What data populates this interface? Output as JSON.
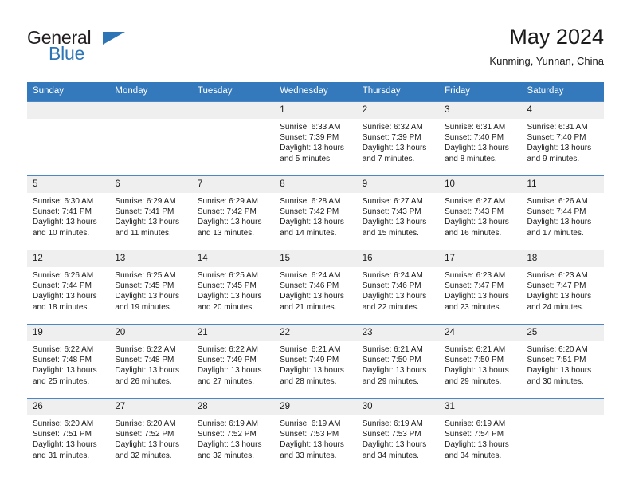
{
  "brand": {
    "name_primary": "General",
    "name_secondary": "Blue",
    "accent_color": "#2e75b6"
  },
  "header": {
    "title": "May 2024",
    "subtitle": "Kunming, Yunnan, China"
  },
  "theme": {
    "header_row_bg": "#3479bc",
    "daynum_bg": "#efefef",
    "row_separator": "#4a87c4"
  },
  "weekdays": [
    "Sunday",
    "Monday",
    "Tuesday",
    "Wednesday",
    "Thursday",
    "Friday",
    "Saturday"
  ],
  "labels": {
    "sunrise_prefix": "Sunrise:",
    "sunset_prefix": "Sunset:",
    "daylight_prefix": "Daylight:"
  },
  "weeks": [
    [
      {
        "day": "",
        "empty": true,
        "sunrise": "",
        "sunset": "",
        "daylight_l1": "",
        "daylight_l2": ""
      },
      {
        "day": "",
        "empty": true,
        "sunrise": "",
        "sunset": "",
        "daylight_l1": "",
        "daylight_l2": ""
      },
      {
        "day": "",
        "empty": true,
        "sunrise": "",
        "sunset": "",
        "daylight_l1": "",
        "daylight_l2": ""
      },
      {
        "day": "1",
        "empty": false,
        "sunrise": "Sunrise: 6:33 AM",
        "sunset": "Sunset: 7:39 PM",
        "daylight_l1": "Daylight: 13 hours",
        "daylight_l2": "and 5 minutes."
      },
      {
        "day": "2",
        "empty": false,
        "sunrise": "Sunrise: 6:32 AM",
        "sunset": "Sunset: 7:39 PM",
        "daylight_l1": "Daylight: 13 hours",
        "daylight_l2": "and 7 minutes."
      },
      {
        "day": "3",
        "empty": false,
        "sunrise": "Sunrise: 6:31 AM",
        "sunset": "Sunset: 7:40 PM",
        "daylight_l1": "Daylight: 13 hours",
        "daylight_l2": "and 8 minutes."
      },
      {
        "day": "4",
        "empty": false,
        "sunrise": "Sunrise: 6:31 AM",
        "sunset": "Sunset: 7:40 PM",
        "daylight_l1": "Daylight: 13 hours",
        "daylight_l2": "and 9 minutes."
      }
    ],
    [
      {
        "day": "5",
        "empty": false,
        "sunrise": "Sunrise: 6:30 AM",
        "sunset": "Sunset: 7:41 PM",
        "daylight_l1": "Daylight: 13 hours",
        "daylight_l2": "and 10 minutes."
      },
      {
        "day": "6",
        "empty": false,
        "sunrise": "Sunrise: 6:29 AM",
        "sunset": "Sunset: 7:41 PM",
        "daylight_l1": "Daylight: 13 hours",
        "daylight_l2": "and 11 minutes."
      },
      {
        "day": "7",
        "empty": false,
        "sunrise": "Sunrise: 6:29 AM",
        "sunset": "Sunset: 7:42 PM",
        "daylight_l1": "Daylight: 13 hours",
        "daylight_l2": "and 13 minutes."
      },
      {
        "day": "8",
        "empty": false,
        "sunrise": "Sunrise: 6:28 AM",
        "sunset": "Sunset: 7:42 PM",
        "daylight_l1": "Daylight: 13 hours",
        "daylight_l2": "and 14 minutes."
      },
      {
        "day": "9",
        "empty": false,
        "sunrise": "Sunrise: 6:27 AM",
        "sunset": "Sunset: 7:43 PM",
        "daylight_l1": "Daylight: 13 hours",
        "daylight_l2": "and 15 minutes."
      },
      {
        "day": "10",
        "empty": false,
        "sunrise": "Sunrise: 6:27 AM",
        "sunset": "Sunset: 7:43 PM",
        "daylight_l1": "Daylight: 13 hours",
        "daylight_l2": "and 16 minutes."
      },
      {
        "day": "11",
        "empty": false,
        "sunrise": "Sunrise: 6:26 AM",
        "sunset": "Sunset: 7:44 PM",
        "daylight_l1": "Daylight: 13 hours",
        "daylight_l2": "and 17 minutes."
      }
    ],
    [
      {
        "day": "12",
        "empty": false,
        "sunrise": "Sunrise: 6:26 AM",
        "sunset": "Sunset: 7:44 PM",
        "daylight_l1": "Daylight: 13 hours",
        "daylight_l2": "and 18 minutes."
      },
      {
        "day": "13",
        "empty": false,
        "sunrise": "Sunrise: 6:25 AM",
        "sunset": "Sunset: 7:45 PM",
        "daylight_l1": "Daylight: 13 hours",
        "daylight_l2": "and 19 minutes."
      },
      {
        "day": "14",
        "empty": false,
        "sunrise": "Sunrise: 6:25 AM",
        "sunset": "Sunset: 7:45 PM",
        "daylight_l1": "Daylight: 13 hours",
        "daylight_l2": "and 20 minutes."
      },
      {
        "day": "15",
        "empty": false,
        "sunrise": "Sunrise: 6:24 AM",
        "sunset": "Sunset: 7:46 PM",
        "daylight_l1": "Daylight: 13 hours",
        "daylight_l2": "and 21 minutes."
      },
      {
        "day": "16",
        "empty": false,
        "sunrise": "Sunrise: 6:24 AM",
        "sunset": "Sunset: 7:46 PM",
        "daylight_l1": "Daylight: 13 hours",
        "daylight_l2": "and 22 minutes."
      },
      {
        "day": "17",
        "empty": false,
        "sunrise": "Sunrise: 6:23 AM",
        "sunset": "Sunset: 7:47 PM",
        "daylight_l1": "Daylight: 13 hours",
        "daylight_l2": "and 23 minutes."
      },
      {
        "day": "18",
        "empty": false,
        "sunrise": "Sunrise: 6:23 AM",
        "sunset": "Sunset: 7:47 PM",
        "daylight_l1": "Daylight: 13 hours",
        "daylight_l2": "and 24 minutes."
      }
    ],
    [
      {
        "day": "19",
        "empty": false,
        "sunrise": "Sunrise: 6:22 AM",
        "sunset": "Sunset: 7:48 PM",
        "daylight_l1": "Daylight: 13 hours",
        "daylight_l2": "and 25 minutes."
      },
      {
        "day": "20",
        "empty": false,
        "sunrise": "Sunrise: 6:22 AM",
        "sunset": "Sunset: 7:48 PM",
        "daylight_l1": "Daylight: 13 hours",
        "daylight_l2": "and 26 minutes."
      },
      {
        "day": "21",
        "empty": false,
        "sunrise": "Sunrise: 6:22 AM",
        "sunset": "Sunset: 7:49 PM",
        "daylight_l1": "Daylight: 13 hours",
        "daylight_l2": "and 27 minutes."
      },
      {
        "day": "22",
        "empty": false,
        "sunrise": "Sunrise: 6:21 AM",
        "sunset": "Sunset: 7:49 PM",
        "daylight_l1": "Daylight: 13 hours",
        "daylight_l2": "and 28 minutes."
      },
      {
        "day": "23",
        "empty": false,
        "sunrise": "Sunrise: 6:21 AM",
        "sunset": "Sunset: 7:50 PM",
        "daylight_l1": "Daylight: 13 hours",
        "daylight_l2": "and 29 minutes."
      },
      {
        "day": "24",
        "empty": false,
        "sunrise": "Sunrise: 6:21 AM",
        "sunset": "Sunset: 7:50 PM",
        "daylight_l1": "Daylight: 13 hours",
        "daylight_l2": "and 29 minutes."
      },
      {
        "day": "25",
        "empty": false,
        "sunrise": "Sunrise: 6:20 AM",
        "sunset": "Sunset: 7:51 PM",
        "daylight_l1": "Daylight: 13 hours",
        "daylight_l2": "and 30 minutes."
      }
    ],
    [
      {
        "day": "26",
        "empty": false,
        "sunrise": "Sunrise: 6:20 AM",
        "sunset": "Sunset: 7:51 PM",
        "daylight_l1": "Daylight: 13 hours",
        "daylight_l2": "and 31 minutes."
      },
      {
        "day": "27",
        "empty": false,
        "sunrise": "Sunrise: 6:20 AM",
        "sunset": "Sunset: 7:52 PM",
        "daylight_l1": "Daylight: 13 hours",
        "daylight_l2": "and 32 minutes."
      },
      {
        "day": "28",
        "empty": false,
        "sunrise": "Sunrise: 6:19 AM",
        "sunset": "Sunset: 7:52 PM",
        "daylight_l1": "Daylight: 13 hours",
        "daylight_l2": "and 32 minutes."
      },
      {
        "day": "29",
        "empty": false,
        "sunrise": "Sunrise: 6:19 AM",
        "sunset": "Sunset: 7:53 PM",
        "daylight_l1": "Daylight: 13 hours",
        "daylight_l2": "and 33 minutes."
      },
      {
        "day": "30",
        "empty": false,
        "sunrise": "Sunrise: 6:19 AM",
        "sunset": "Sunset: 7:53 PM",
        "daylight_l1": "Daylight: 13 hours",
        "daylight_l2": "and 34 minutes."
      },
      {
        "day": "31",
        "empty": false,
        "sunrise": "Sunrise: 6:19 AM",
        "sunset": "Sunset: 7:54 PM",
        "daylight_l1": "Daylight: 13 hours",
        "daylight_l2": "and 34 minutes."
      },
      {
        "day": "",
        "empty": true,
        "sunrise": "",
        "sunset": "",
        "daylight_l1": "",
        "daylight_l2": ""
      }
    ]
  ]
}
